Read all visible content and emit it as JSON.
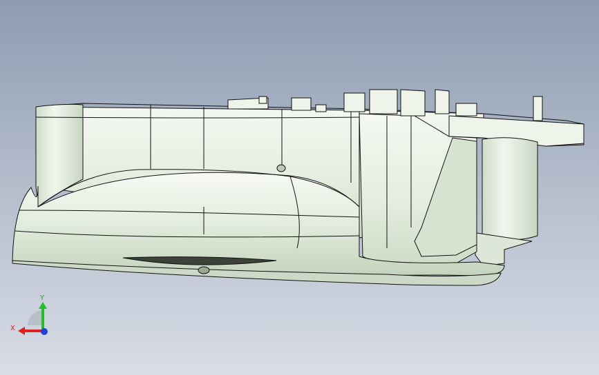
{
  "viewport": {
    "background_top": "#8e9cb1",
    "background_bottom": "#d8dde6",
    "model_fill": "#e6f0e0",
    "model_shade": "#c7d6c1",
    "edge_color": "#111111"
  },
  "triad": {
    "x_label": "X",
    "y_label": "Y",
    "x_color": "#e02020",
    "y_color": "#20c020",
    "z_color": "#2040e0"
  }
}
